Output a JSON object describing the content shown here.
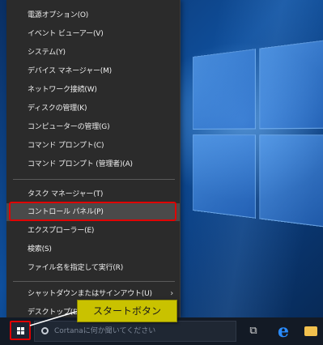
{
  "menu": {
    "items": [
      {
        "label": "電源オプション(O)"
      },
      {
        "label": "イベント ビューアー(V)"
      },
      {
        "label": "システム(Y)"
      },
      {
        "label": "デバイス マネージャー(M)"
      },
      {
        "label": "ネットワーク接続(W)"
      },
      {
        "label": "ディスクの管理(K)"
      },
      {
        "label": "コンピューターの管理(G)"
      },
      {
        "label": "コマンド プロンプト(C)"
      },
      {
        "label": "コマンド プロンプト (管理者)(A)"
      },
      {
        "label": "タスク マネージャー(T)"
      },
      {
        "label": "コントロール パネル(P)"
      },
      {
        "label": "エクスプローラー(E)"
      },
      {
        "label": "検索(S)"
      },
      {
        "label": "ファイル名を指定して実行(R)"
      },
      {
        "label": "シャットダウンまたはサインアウト(U)"
      },
      {
        "label": "デスクトップ(D)"
      }
    ],
    "submenu_arrow": "›",
    "highlighted_item": "コントロール パネル(P)"
  },
  "taskbar": {
    "search_placeholder": "Cortanaに何か聞いてください",
    "icons": [
      "start-icon",
      "search-icon",
      "task-view-icon",
      "edge-icon",
      "file-explorer-icon"
    ],
    "task_view_glyph": "⧉",
    "edge_glyph": "e"
  },
  "callout": {
    "text": "スタートボタン"
  },
  "colors": {
    "highlight": "#e00000",
    "callout_bg": "#c9c200",
    "menu_bg": "#2b2b2b"
  }
}
